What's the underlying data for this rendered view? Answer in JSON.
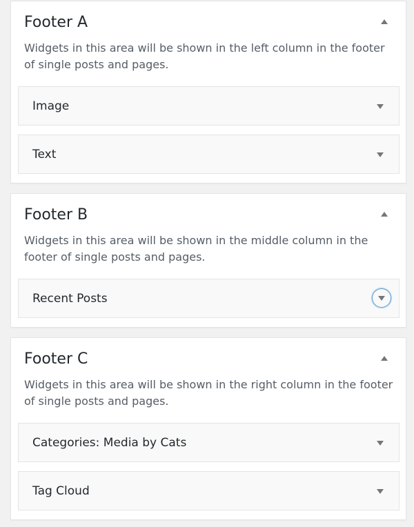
{
  "sidebars": [
    {
      "title": "Footer A",
      "description": "Widgets in this area will be shown in the left column in the footer of single posts and pages.",
      "widgets": [
        {
          "title": "Image",
          "suffix": ""
        },
        {
          "title": "Text",
          "suffix": ""
        }
      ]
    },
    {
      "title": "Footer B",
      "description": "Widgets in this area will be shown in the middle column in the footer of single posts and pages.",
      "widgets": [
        {
          "title": "Recent Posts",
          "suffix": ""
        }
      ]
    },
    {
      "title": "Footer C",
      "description": "Widgets in this area will be shown in the right column in the footer of single posts and pages.",
      "widgets": [
        {
          "title": "Categories:",
          "suffix": "Media by Cats"
        },
        {
          "title": "Tag Cloud",
          "suffix": ""
        }
      ]
    }
  ],
  "icons": {
    "collapse": "arrow-up-icon",
    "expand": "arrow-down-icon"
  },
  "colors": {
    "focus_ring": "#5b9dd9",
    "panel_background": "#ffffff",
    "widget_background": "#f9f9f9",
    "page_background": "#f1f1f1"
  }
}
